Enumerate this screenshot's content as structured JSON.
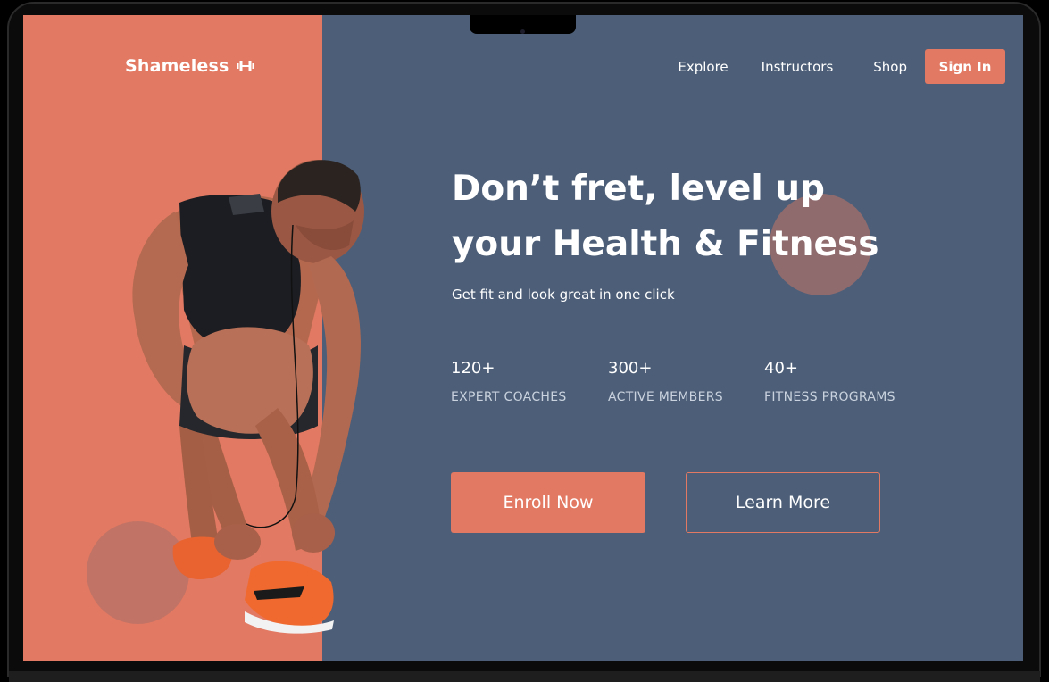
{
  "brand": {
    "name": "Shameless",
    "icon": "dumbbell-icon"
  },
  "nav": {
    "items": [
      {
        "label": "Explore"
      },
      {
        "label": "Instructors"
      },
      {
        "label": "Shop"
      }
    ],
    "signin_label": "Sign In"
  },
  "hero": {
    "title_line1": "Don’t fret, level up",
    "title_line2": "your Health & Fitness",
    "subtitle": "Get fit and look great in one click",
    "stats": [
      {
        "value": "120+",
        "label": "EXPERT COACHES"
      },
      {
        "value": "300+",
        "label": "ACTIVE MEMBERS"
      },
      {
        "value": "40+",
        "label": "FITNESS PROGRAMS"
      }
    ],
    "primary_cta": "Enroll Now",
    "secondary_cta": "Learn More"
  },
  "colors": {
    "accent": "#e27962",
    "background": "#4d5f78",
    "text": "#ffffff"
  }
}
